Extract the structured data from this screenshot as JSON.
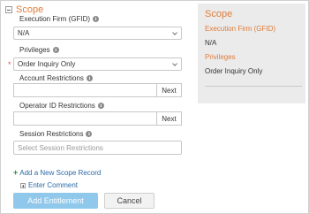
{
  "scope": {
    "title": "Scope",
    "execution_firm": {
      "label": "Execution Firm (GFID)",
      "value": "N/A"
    },
    "privileges": {
      "label": "Privileges",
      "value": "Order Inquiry Only",
      "required_marker": "*"
    },
    "account_restrictions": {
      "label": "Account Restrictions",
      "value": "",
      "next_label": "Next"
    },
    "operator_id_restrictions": {
      "label": "Operator ID Restrictions",
      "value": "",
      "next_label": "Next"
    },
    "session_restrictions": {
      "label": "Session Restrictions",
      "placeholder": "Select Session Restrictions"
    },
    "info_glyph": "i"
  },
  "actions": {
    "add_scope_plus": "+",
    "add_scope_label": "Add a New Scope Record",
    "enter_comment_label": "Enter Comment",
    "add_entitlement_label": "Add Entitlement",
    "cancel_label": "Cancel"
  },
  "summary": {
    "title": "Scope",
    "execution_firm_label": "Execution Firm (GFID)",
    "execution_firm_value": "N/A",
    "privileges_label": "Privileges",
    "privileges_value": "Order Inquiry Only"
  },
  "colors": {
    "accent": "#e07b39",
    "link": "#2b6aa6",
    "primary_button": "#8fc8ea",
    "required": "#d9534f"
  }
}
